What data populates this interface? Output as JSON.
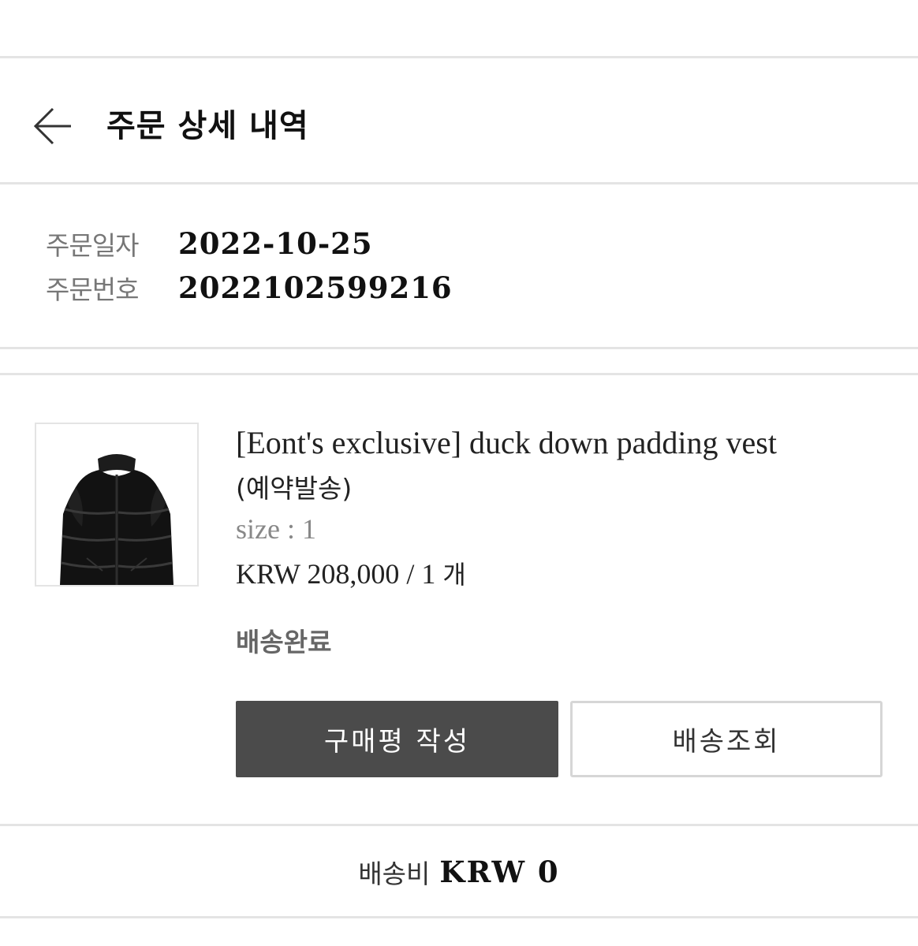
{
  "header": {
    "title": "주문 상세 내역"
  },
  "order": {
    "date_label": "주문일자",
    "date_value": "2022-10-25",
    "number_label": "주문번호",
    "number_value": "2022102599216"
  },
  "product": {
    "name": "[Eont's exclusive] duck down padding vest",
    "name_suffix": "(예약발송)",
    "size": "size : 1",
    "price": "KRW 208,000 / 1",
    "quantity_unit": "개",
    "status": "배송완료",
    "image_icon": "black-padded-vest"
  },
  "actions": {
    "review_label": "구매평 작성",
    "track_label": "배송조회"
  },
  "shipping": {
    "label": "배송비",
    "value": "KRW 0"
  },
  "colors": {
    "primary_button": "#4b4b4b",
    "divider": "#e4e4e4",
    "muted_text": "#777777"
  }
}
